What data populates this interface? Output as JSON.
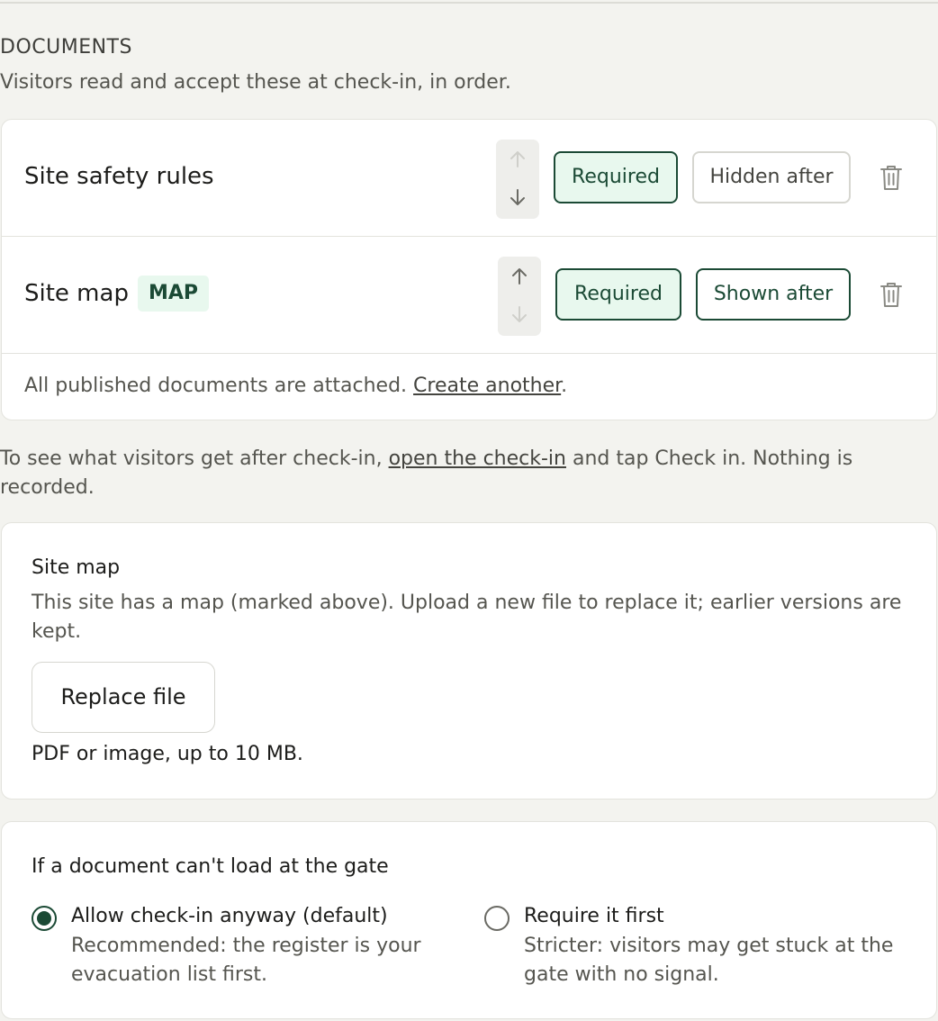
{
  "documents": {
    "title": "DOCUMENTS",
    "description": "Visitors read and accept these at check-in, in order.",
    "items": [
      {
        "name": "Site safety rules",
        "required_label": "Required",
        "visibility_label": "Hidden after",
        "move_up_enabled": false,
        "move_down_enabled": true
      },
      {
        "name": "Site map",
        "tag": "MAP",
        "required_label": "Required",
        "visibility_label": "Shown after",
        "move_up_enabled": true,
        "move_down_enabled": false
      }
    ],
    "footer_text": "All published documents are attached.",
    "footer_link": "Create another",
    "footer_end": "."
  },
  "preview_info": {
    "text_before": "To see what visitors get after check-in,",
    "link": "open the check-in",
    "text_after": "and tap Check in. Nothing is recorded."
  },
  "site_map": {
    "title": "Site map",
    "description": "This site has a map (marked above). Upload a new file to replace it; earlier versions are kept.",
    "button_label": "Replace file",
    "hint": "PDF or image, up to 10 MB."
  },
  "gate_fallback": {
    "title": "If a document can't load at the gate",
    "options": [
      {
        "label": "Allow check-in anyway (default)",
        "description": "Recommended: the register is your evacuation list first.",
        "selected": true
      },
      {
        "label": "Require it first",
        "description": "Stricter: visitors may get stuck at the gate with no signal.",
        "selected": false
      }
    ]
  },
  "colors": {
    "accent": "#1b4a35",
    "accent_bg": "#e8f8ee",
    "page_bg": "#f3f3ef"
  },
  "icons": [
    "arrow-up-icon",
    "arrow-down-icon",
    "trash-icon",
    "radio-checked-icon",
    "radio-unchecked-icon"
  ]
}
